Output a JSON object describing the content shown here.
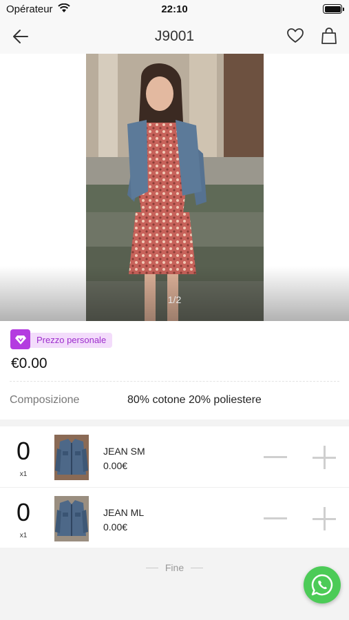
{
  "status_bar": {
    "carrier": "Opérateur",
    "time": "22:10"
  },
  "nav": {
    "title": "J9001"
  },
  "gallery": {
    "indicator": "1/2"
  },
  "product": {
    "badge": "Prezzo personale",
    "price": "€0.00",
    "composition_label": "Composizione",
    "composition_value": "80% cotone 20% poliestere"
  },
  "variants": [
    {
      "name": "JEAN SM",
      "price": "0.00€",
      "qty": "0",
      "unit": "x1"
    },
    {
      "name": "JEAN ML",
      "price": "0.00€",
      "qty": "0",
      "unit": "x1"
    }
  ],
  "footer": {
    "end_text": "Fine"
  },
  "colors": {
    "accent": "#b43be0",
    "badge_bg": "#f3dcfb",
    "whatsapp": "#4ccb57"
  },
  "icons": [
    "back-arrow-icon",
    "heart-icon",
    "shopping-bag-icon",
    "diamond-icon",
    "whatsapp-icon"
  ]
}
